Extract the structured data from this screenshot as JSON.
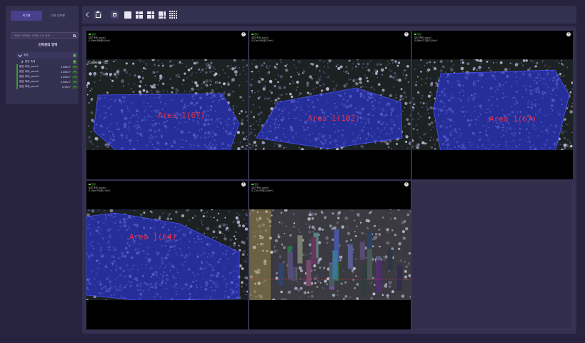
{
  "sidebar": {
    "tabs": [
      {
        "label": "위치별",
        "active": true
      },
      {
        "label": "인파 상태별",
        "active": false
      }
    ],
    "search": {
      "placeholder": "카메라 관리번호, 카메라 주소 검색"
    },
    "section_title": "인파관리 영역",
    "tree": {
      "root": {
        "label": "축제",
        "count": "5"
      },
      "group": {
        "label": "알암 축제",
        "count": "5"
      },
      "items": [
        {
          "label": "알암 축제_zone1",
          "value": "0.088m²",
          "badge": "0"
        },
        {
          "label": "알암 축제_zone2",
          "value": "0.086m²",
          "badge": "0"
        },
        {
          "label": "알암 축제_zone3",
          "value": "0.088m²",
          "badge": "0"
        },
        {
          "label": "알암 축제_zone4",
          "value": "0.088m²",
          "badge": "0"
        },
        {
          "label": "알암 축제_zone5",
          "value": "0.58m²",
          "badge": "0"
        }
      ]
    }
  },
  "toolbar": {
    "icons": [
      "back-icon",
      "home-icon",
      "save-icon",
      "layout-1x1-icon",
      "layout-2x2-icon",
      "layout-3x2-icon",
      "layout-3x3-icon",
      "layout-4x4-icon"
    ]
  },
  "cameras": [
    {
      "status": "정상",
      "name": "알암 축제_zone1",
      "info": "0.49m²/66명(61m²)",
      "area_label": "Area 1(67)",
      "overlay": "blue",
      "cam_header": "Camera 01"
    },
    {
      "status": "정상",
      "name": "알암 축제_zone2",
      "info": "0.53m²/64명(33m²)",
      "area_label": "Area 1(102)",
      "overlay": "blue",
      "cam_header": ""
    },
    {
      "status": "정상",
      "name": "알암 축제_zone3",
      "info": "0.48m²/22명(320m²)",
      "area_label": "Area 1(67)",
      "overlay": "blue",
      "cam_header": ""
    },
    {
      "status": "정상",
      "name": "알암 축제_zone4",
      "info": "0.18m²/90명(74m²)",
      "area_label": "Area 1(64)",
      "overlay": "blue",
      "cam_header": ""
    },
    {
      "status": "정상",
      "name": "알암 축제_zone5",
      "info": "0.12m²/9명(106m²)",
      "area_label": "",
      "overlay": "none",
      "cam_header": ""
    }
  ],
  "colors": {
    "background": "#27233e",
    "panel": "#34304f",
    "accent": "#4a3f8c",
    "status_ok": "#5fd140",
    "overlay": "#2a33c8",
    "area_label": "#e5324a"
  }
}
